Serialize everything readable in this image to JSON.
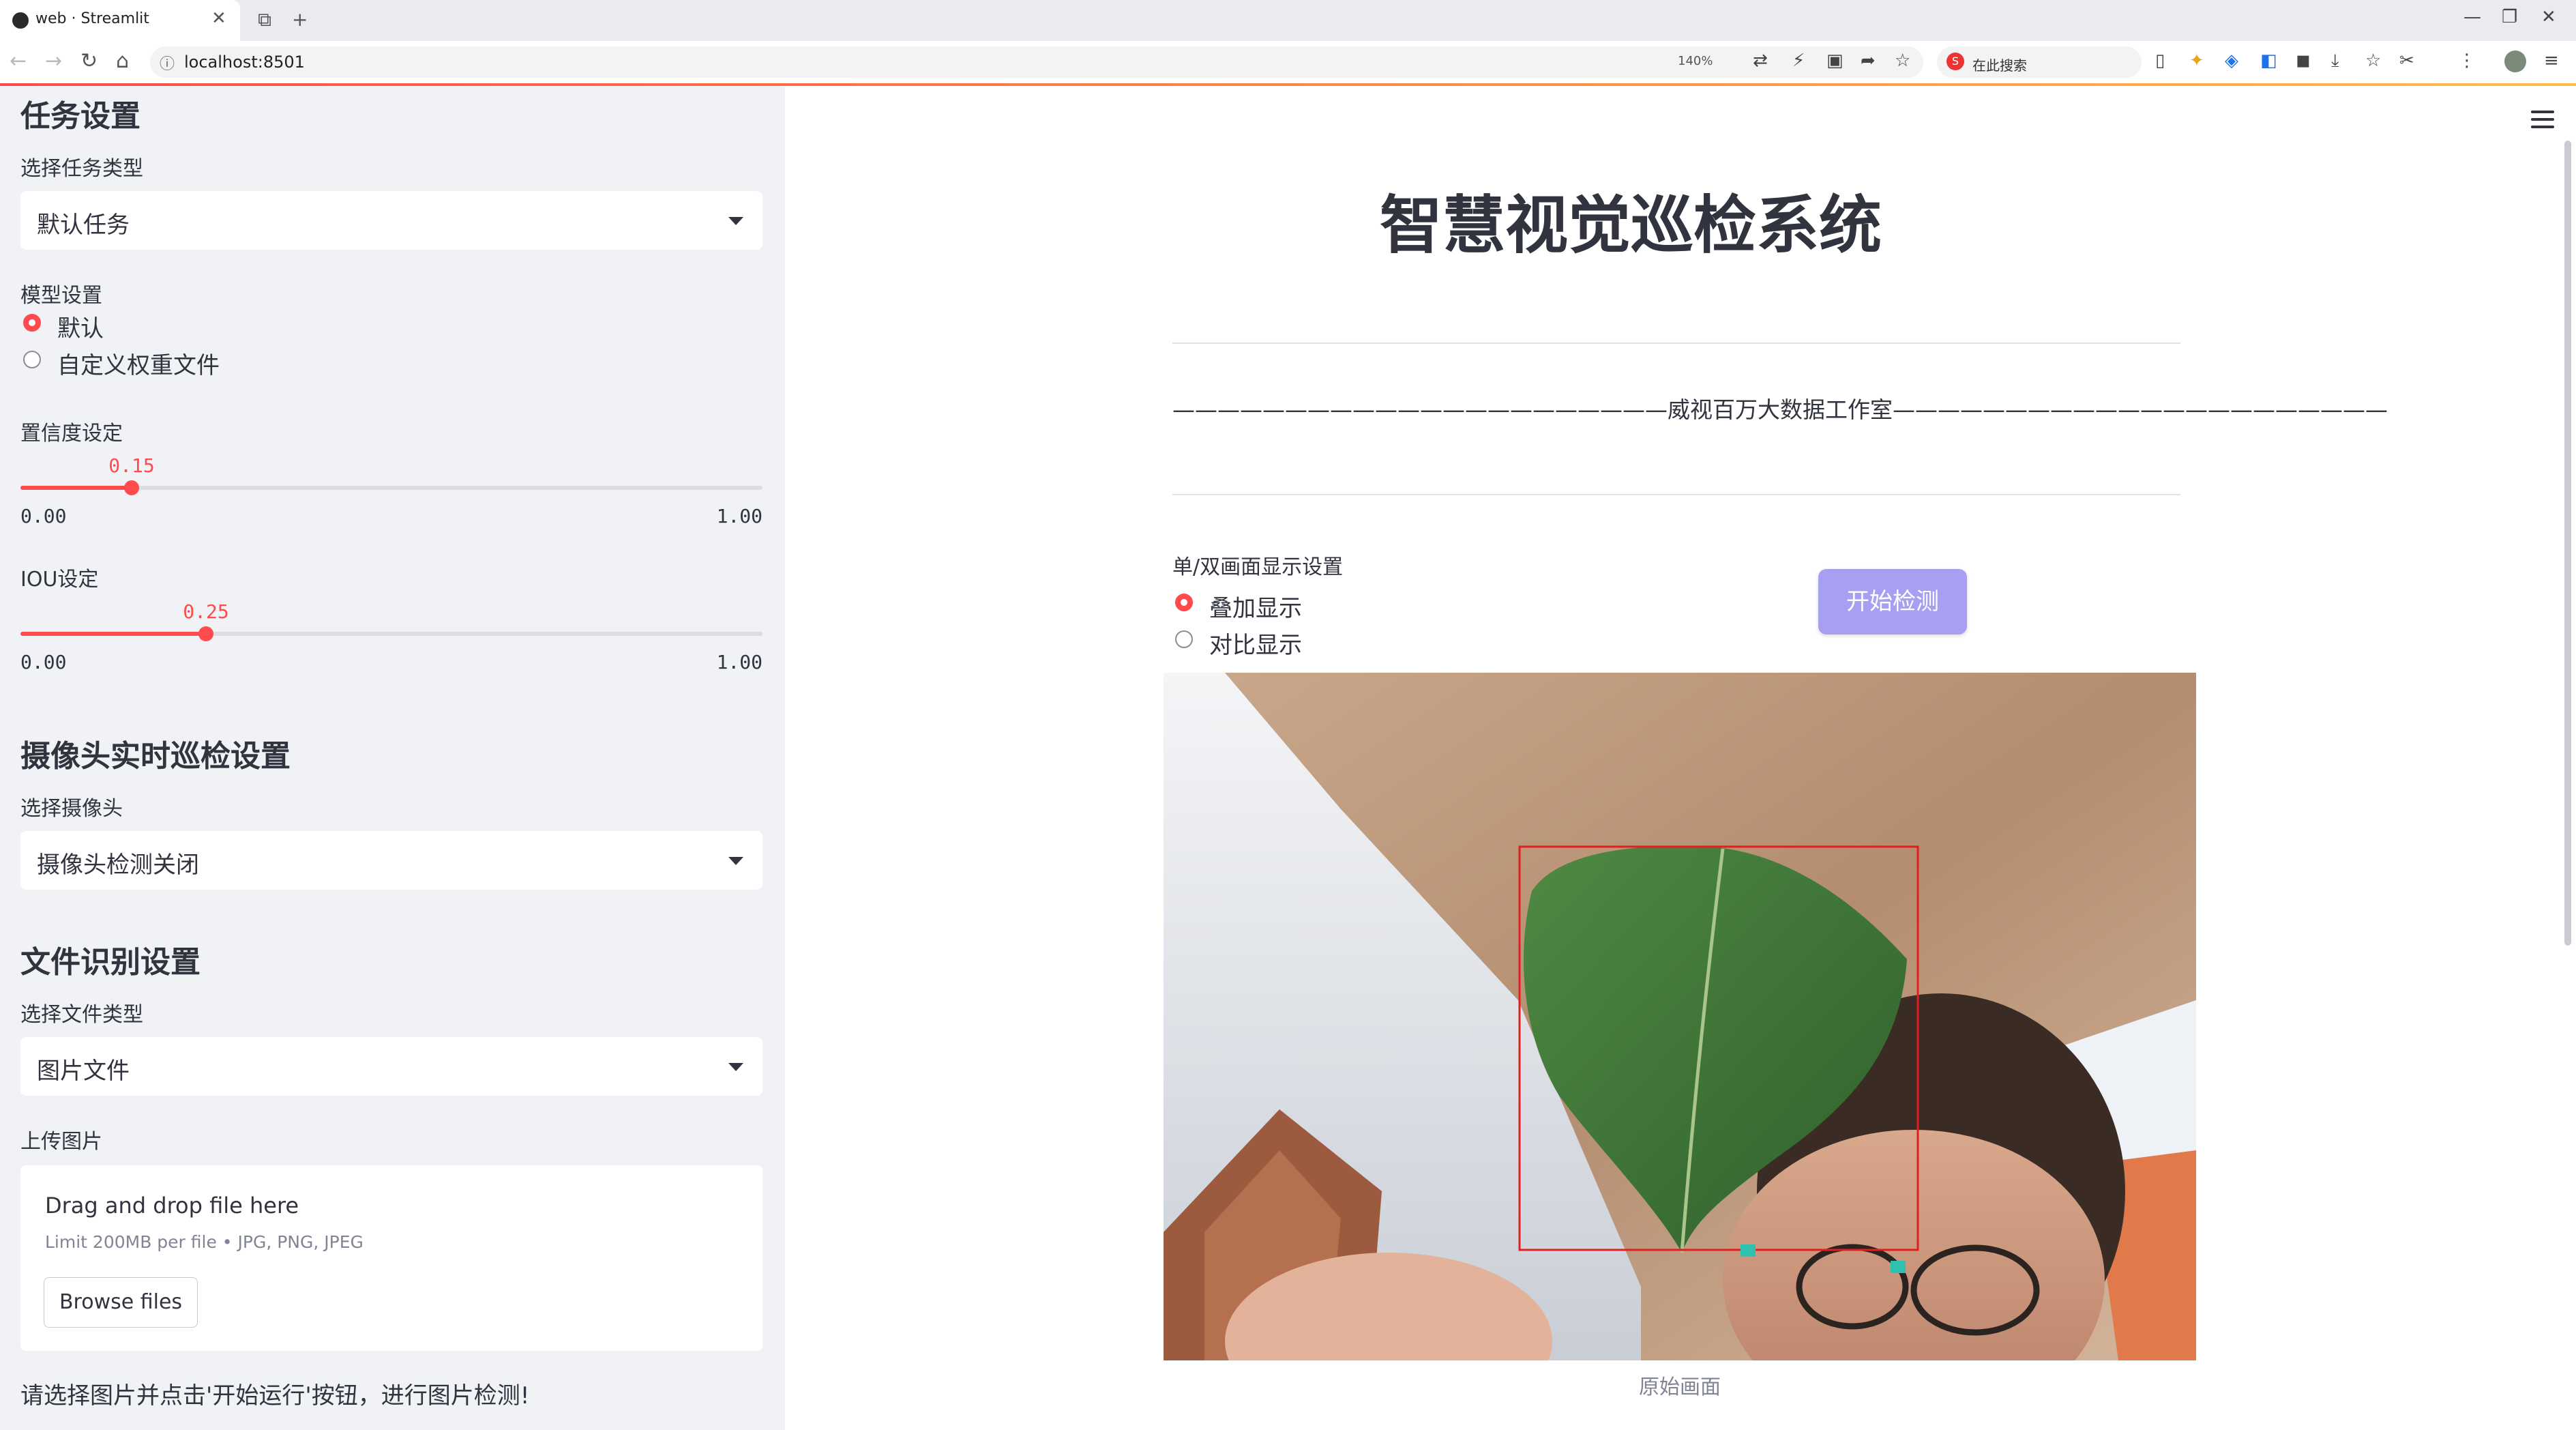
{
  "browser": {
    "tab_title": "web · Streamlit",
    "url": "localhost:8501",
    "zoom": "140%",
    "search_placeholder": "在此搜索"
  },
  "sidebar": {
    "task_section_title": "任务设置",
    "task_type_label": "选择任务类型",
    "task_type_value": "默认任务",
    "model_label": "模型设置",
    "model_options": [
      "默认",
      "自定义权重文件"
    ],
    "model_selected": "默认",
    "confidence": {
      "label": "置信度设定",
      "value": "0.15",
      "min": "0.00",
      "max": "1.00",
      "fraction": 0.15
    },
    "iou": {
      "label": "IOU设定",
      "value": "0.25",
      "min": "0.00",
      "max": "1.00",
      "fraction": 0.25
    },
    "camera_section_title": "摄像头实时巡检设置",
    "camera_label": "选择摄像头",
    "camera_value": "摄像头检测关闭",
    "file_section_title": "文件识别设置",
    "file_type_label": "选择文件类型",
    "file_type_value": "图片文件",
    "upload_label": "上传图片",
    "uploader": {
      "drop_text": "Drag and drop file here",
      "limit_text": "Limit 200MB per file • JPG, PNG, JPEG",
      "browse_label": "Browse files"
    },
    "note": "请选择图片并点击'开始运行'按钮，进行图片检测!"
  },
  "main": {
    "title": "智慧视觉巡检系统",
    "studio_line": "——————————————————————威视百万大数据工作室——————————————————————",
    "display_label": "单/双画面显示设置",
    "display_options": [
      "叠加显示",
      "对比显示"
    ],
    "display_selected": "叠加显示",
    "start_button": "开始检测",
    "image_caption": "原始画面",
    "detection_box_color": "#e02020"
  },
  "colors": {
    "accent": "#ff4b4b",
    "button": "#a7a0f2",
    "sidebar_bg": "#f0f2f6"
  }
}
